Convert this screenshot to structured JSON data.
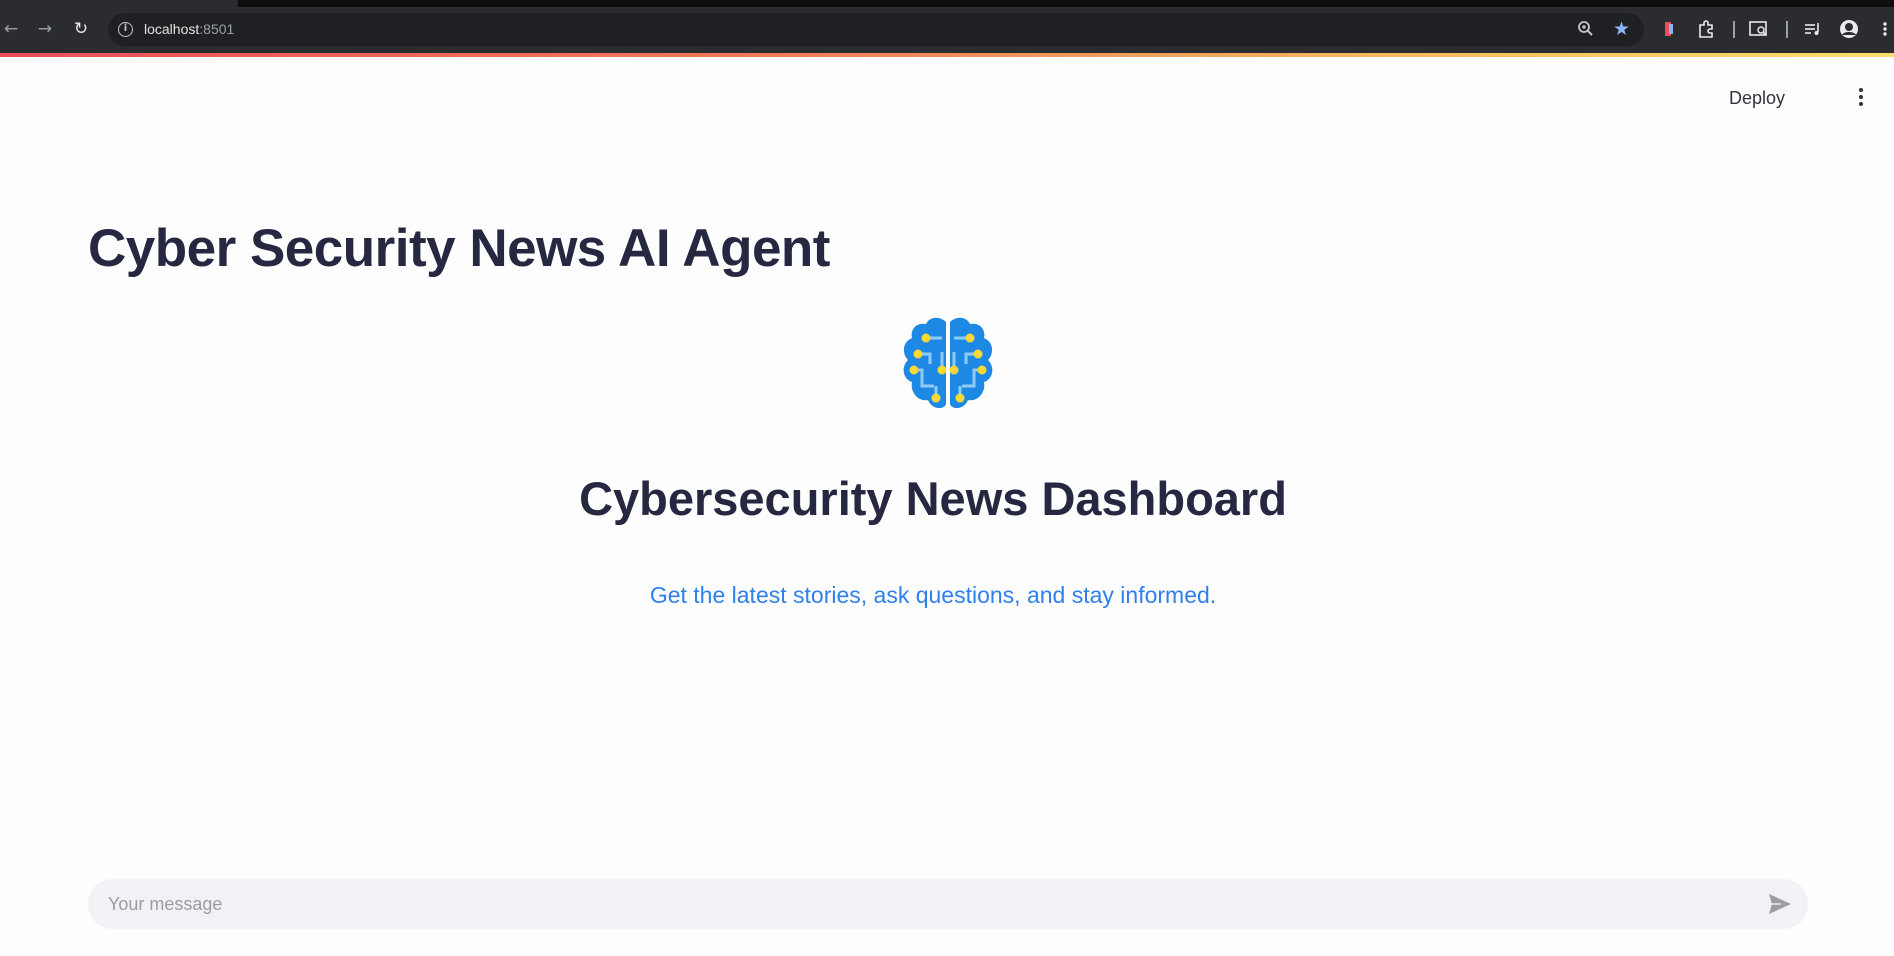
{
  "browser": {
    "url_host": "localhost",
    "url_port": ":8501",
    "accent_color": "#8ab4f8"
  },
  "header": {
    "deploy_label": "Deploy"
  },
  "main": {
    "title": "Cyber Security News AI Agent",
    "logo_icon": "brain-circuit-icon",
    "dashboard_title": "Cybersecurity News Dashboard",
    "subtitle": "Get the latest stories, ask questions, and stay informed.",
    "subtitle_color": "#2f80ed",
    "title_color": "#262740"
  },
  "chat": {
    "placeholder": "Your message",
    "value": ""
  }
}
